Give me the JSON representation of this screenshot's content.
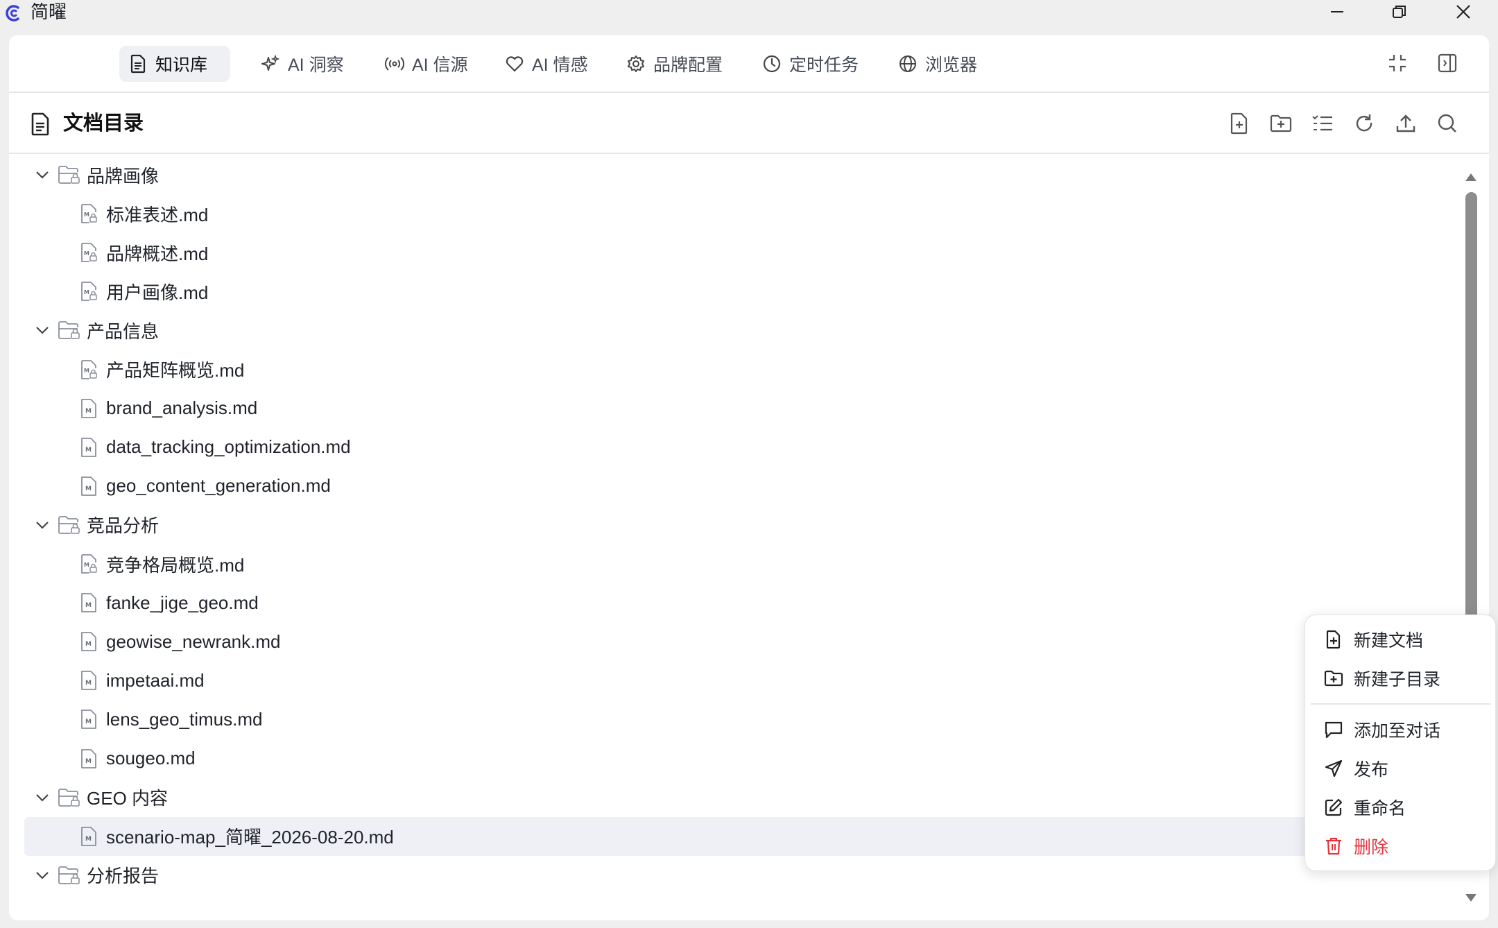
{
  "window": {
    "title": "简曜"
  },
  "nav": {
    "tabs": [
      {
        "label": "知识库",
        "icon": "document-icon",
        "active": true
      },
      {
        "label": "AI 洞察",
        "icon": "sparkles-icon"
      },
      {
        "label": "AI 信源",
        "icon": "broadcast-icon"
      },
      {
        "label": "AI 情感",
        "icon": "heart-icon"
      },
      {
        "label": "品牌配置",
        "icon": "gear-icon"
      },
      {
        "label": "定时任务",
        "icon": "clock-icon"
      },
      {
        "label": "浏览器",
        "icon": "globe-icon"
      }
    ]
  },
  "section": {
    "title": "文档目录",
    "toolbar": [
      "new-document-icon",
      "new-folder-icon",
      "list-icon",
      "refresh-icon",
      "upload-icon",
      "search-icon"
    ]
  },
  "tree": {
    "folders": [
      {
        "label": "品牌画像",
        "files": [
          "标准表述.md",
          "品牌概述.md",
          "用户画像.md"
        ]
      },
      {
        "label": "产品信息",
        "files": [
          "产品矩阵概览.md",
          "brand_analysis.md",
          "data_tracking_optimization.md",
          "geo_content_generation.md"
        ]
      },
      {
        "label": "竞品分析",
        "files": [
          "竞争格局概览.md",
          "fanke_jige_geo.md",
          "geowise_newrank.md",
          "impetaai.md",
          "lens_geo_timus.md",
          "sougeo.md"
        ]
      },
      {
        "label": "GEO 内容",
        "files": [
          "scenario-map_简曜_2026-08-20.md"
        ]
      },
      {
        "label": "分析报告",
        "files": []
      }
    ],
    "selected_file": "scenario-map_简曜_2026-08-20.md"
  },
  "context_menu": {
    "items": [
      {
        "label": "新建文档",
        "icon": "file-plus-icon"
      },
      {
        "label": "新建子目录",
        "icon": "folder-plus-icon"
      },
      {
        "label": "添加至对话",
        "icon": "message-icon"
      },
      {
        "label": "发布",
        "icon": "send-icon"
      },
      {
        "label": "重命名",
        "icon": "edit-icon"
      },
      {
        "label": "删除",
        "icon": "trash-icon",
        "danger": true
      }
    ]
  },
  "colors": {
    "danger": "#e5333a",
    "selected_bg": "#eef0f5",
    "active_tab_bg": "#eef0f3"
  }
}
